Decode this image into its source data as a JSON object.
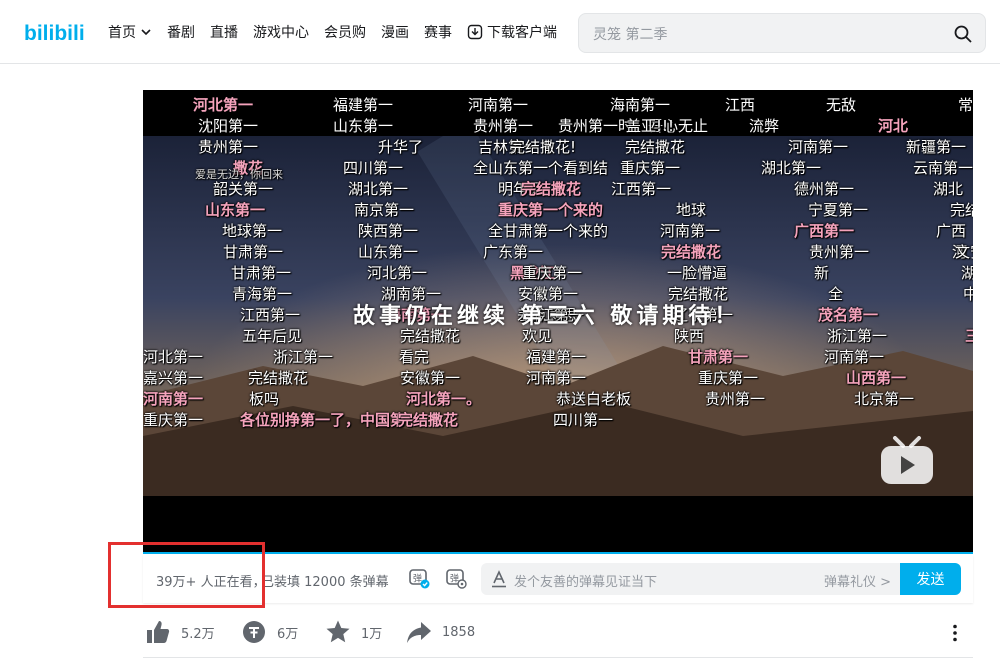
{
  "header": {
    "logo_text": "bilibili",
    "nav": [
      {
        "label": "首页",
        "has_chevron": true
      },
      {
        "label": "番剧"
      },
      {
        "label": "直播"
      },
      {
        "label": "游戏中心"
      },
      {
        "label": "会员购"
      },
      {
        "label": "漫画"
      },
      {
        "label": "赛事"
      },
      {
        "label": "下载客户端",
        "icon": "download-icon"
      }
    ],
    "search": {
      "placeholder": "灵笼 第二季",
      "icon": "search-icon"
    }
  },
  "player": {
    "subtitle": "故事仍在继续  第三六 敬请期待！",
    "watermark": "bilibili",
    "danmaku": [
      {
        "text": "河北第一",
        "style": "pink"
      },
      {
        "text": "福建第一"
      },
      {
        "text": "河南第一"
      },
      {
        "text": "海南第一"
      },
      {
        "text": "江西"
      },
      {
        "text": "无敌"
      },
      {
        "text": "常"
      },
      {
        "text": "沈阳第一"
      },
      {
        "text": "山东第一"
      },
      {
        "text": "贵州第一"
      },
      {
        "text": "贵州第一时，吾心无止"
      },
      {
        "text": "盖亚!!!"
      },
      {
        "text": "流弊"
      },
      {
        "text": "河北",
        "style": "pink"
      },
      {
        "text": "贵州第一"
      },
      {
        "text": "升华了"
      },
      {
        "text": "吉林第一"
      },
      {
        "text": "完结撒花!"
      },
      {
        "text": "完结撒花"
      },
      {
        "text": "河南第一"
      },
      {
        "text": "新疆第一"
      },
      {
        "text": "撒花",
        "style": "pink"
      },
      {
        "text": "爱是无边，你回来",
        "style": "small"
      },
      {
        "text": "四川第一"
      },
      {
        "text": "全山东第一个看到结"
      },
      {
        "text": "重庆第一"
      },
      {
        "text": "湖北第一"
      },
      {
        "text": "云南第一"
      },
      {
        "text": "韶关第一"
      },
      {
        "text": "湖北第一"
      },
      {
        "text": "明年见"
      },
      {
        "text": "完结撒花",
        "style": "pink"
      },
      {
        "text": "江西第一"
      },
      {
        "text": "德州第一"
      },
      {
        "text": "湖北"
      },
      {
        "text": "山东第一",
        "style": "pink"
      },
      {
        "text": "南京第一"
      },
      {
        "text": "重庆第一个来的",
        "style": "pink"
      },
      {
        "text": "地球"
      },
      {
        "text": "宁夏第一"
      },
      {
        "text": "完结"
      },
      {
        "text": "地球第一"
      },
      {
        "text": "陕西第一"
      },
      {
        "text": "全甘肃第一个来的"
      },
      {
        "text": "河南第一"
      },
      {
        "text": "广西第一",
        "style": "pink"
      },
      {
        "text": "广西"
      },
      {
        "text": "甘肃第一"
      },
      {
        "text": "山东第一"
      },
      {
        "text": "广东第一"
      },
      {
        "text": "完结撒花",
        "style": "pink"
      },
      {
        "text": "贵州第一"
      },
      {
        "text": "河"
      },
      {
        "text": "文安第一"
      },
      {
        "text": "甘肃第一"
      },
      {
        "text": "河北第一"
      },
      {
        "text": "黑龙江",
        "style": "pink"
      },
      {
        "text": "重庆第一"
      },
      {
        "text": "一脸懵逼"
      },
      {
        "text": "新"
      },
      {
        "text": "湖南第一"
      },
      {
        "text": "青海第一"
      },
      {
        "text": "湖南第一"
      },
      {
        "text": "安徽第一"
      },
      {
        "text": "完结撒花"
      },
      {
        "text": "全"
      },
      {
        "text": "中国第一"
      },
      {
        "text": "江西第一"
      },
      {
        "text": "海南第一",
        "style": "pink"
      },
      {
        "text": "差点意思"
      },
      {
        "text": "浙江第一"
      },
      {
        "text": "辽宁第一"
      },
      {
        "text": "茂名第一",
        "style": "pink"
      },
      {
        "text": "五年后见"
      },
      {
        "text": "完结撒花"
      },
      {
        "text": "欢见"
      },
      {
        "text": "陕西"
      },
      {
        "text": "浙江第一"
      },
      {
        "text": "三江西第一",
        "style": "pink"
      },
      {
        "text": "河北第一"
      },
      {
        "text": "浙江第一"
      },
      {
        "text": "看完"
      },
      {
        "text": "福建第一"
      },
      {
        "text": "甘肃第一",
        "style": "pink"
      },
      {
        "text": "河南第一"
      },
      {
        "text": "嘉兴第一"
      },
      {
        "text": "完结撒花"
      },
      {
        "text": "安徽第一"
      },
      {
        "text": "河南第一"
      },
      {
        "text": "重庆第一"
      },
      {
        "text": "山西第一",
        "style": "pink"
      },
      {
        "text": "河南第一",
        "style": "pink"
      },
      {
        "text": "板吗"
      },
      {
        "text": "河北第一。",
        "style": "pink"
      },
      {
        "text": "恭送白老板"
      },
      {
        "text": "贵州第一"
      },
      {
        "text": "北京第一"
      },
      {
        "text": "重庆第一"
      },
      {
        "text": "各位别挣第一了，中国第一",
        "style": "pink"
      },
      {
        "text": "完结撒花",
        "style": "pink"
      },
      {
        "text": "四川第一"
      }
    ]
  },
  "sendbar": {
    "watching": "39万+ 人正在看，",
    "loaded": "已装填 12000 条弹幕",
    "placeholder": "发个友善的弹幕见证当下",
    "etiquette": "弹幕礼仪 >",
    "send": "发送"
  },
  "actions": {
    "like": "5.2万",
    "coin": "6万",
    "favorite": "1万",
    "share": "1858"
  },
  "colors": {
    "accent": "#00aeec",
    "highlight": "#e3302f",
    "danmaku_pink": "#f5a3bc"
  }
}
